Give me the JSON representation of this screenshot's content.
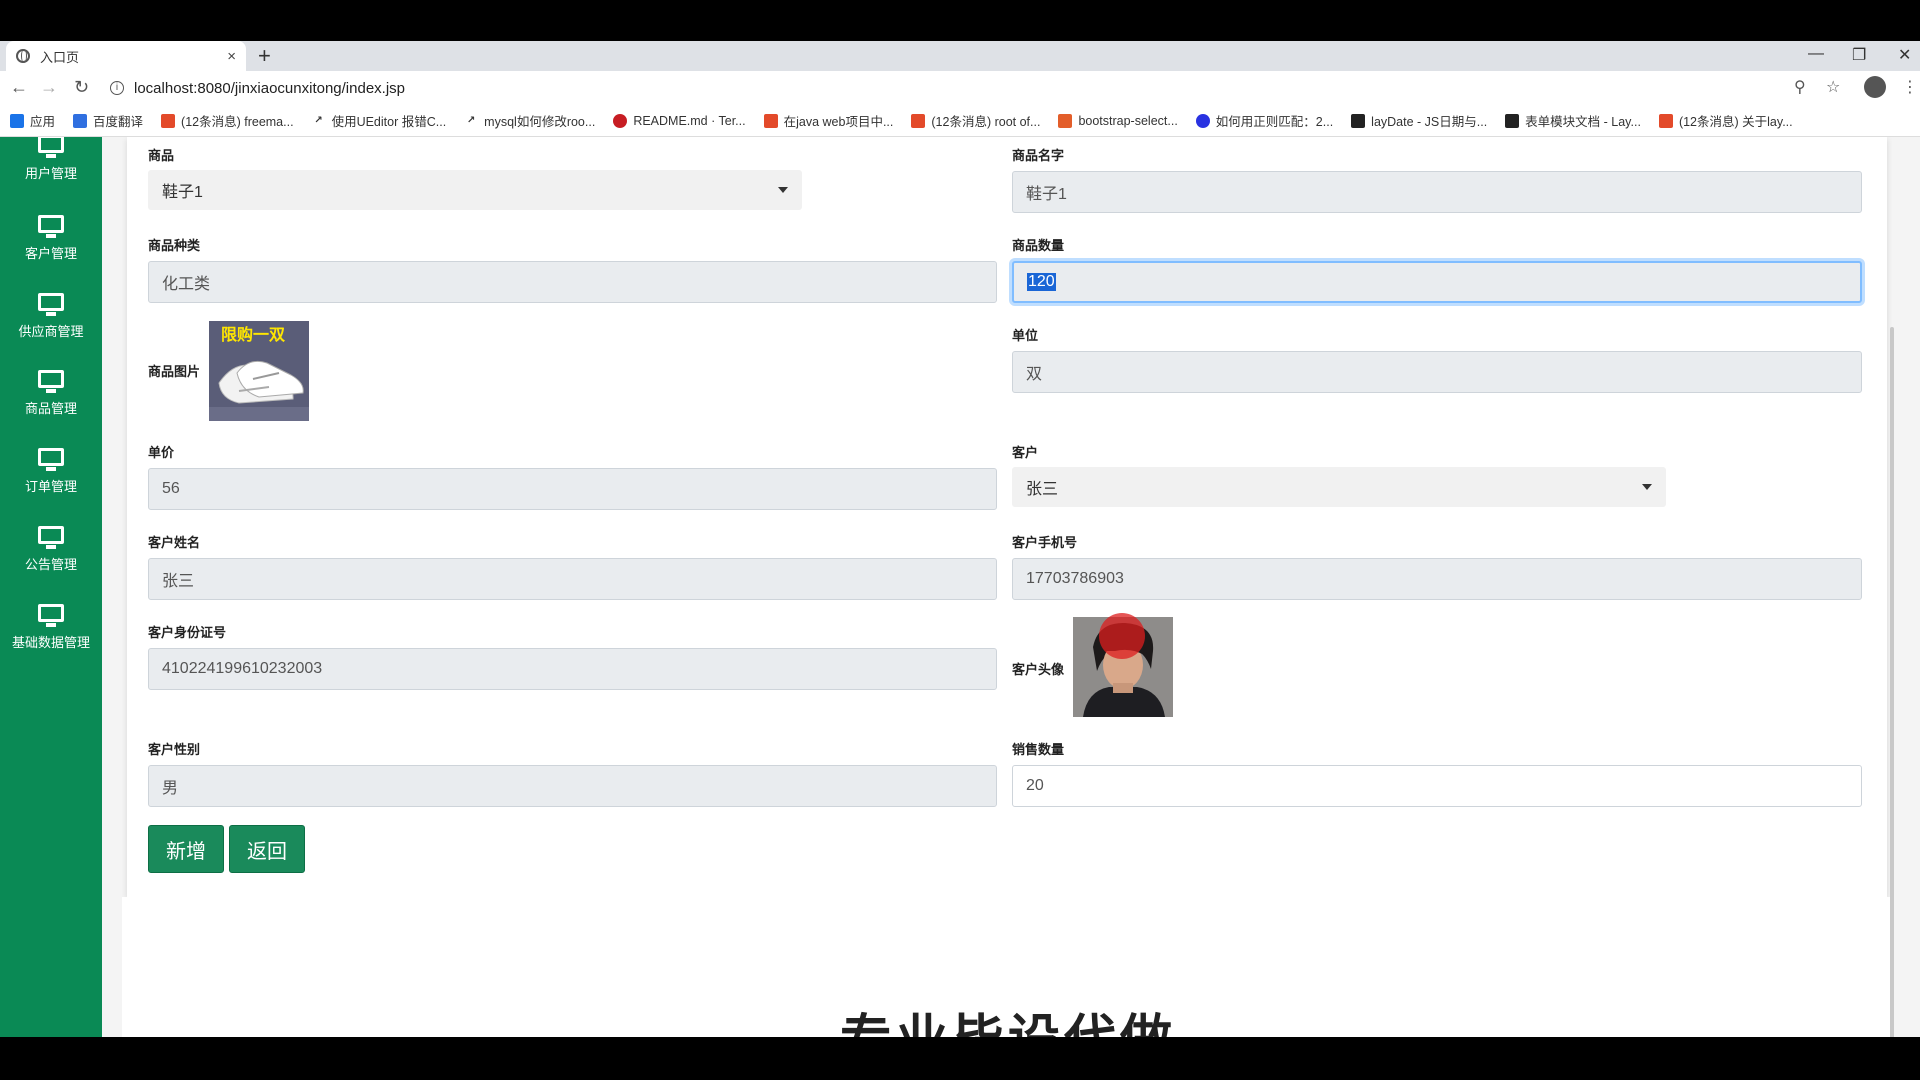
{
  "browser": {
    "tab_title": "入口页",
    "tab_close": "×",
    "new_tab": "+",
    "url": "localhost:8080/jinxiaocunxitong/index.jsp",
    "bookmarks": [
      {
        "label": "应用",
        "icon": "apps-icon",
        "color": "#1a73e8"
      },
      {
        "label": "百度翻译",
        "icon": "baidu-translate-icon",
        "color": "#2f6fe0"
      },
      {
        "label": "(12条消息) freema...",
        "icon": "csdn-icon",
        "color": "#e34a2a"
      },
      {
        "label": "使用UEditor 报错C...",
        "icon": "arrow-icon",
        "color": "#333333"
      },
      {
        "label": "mysql如何修改roo...",
        "icon": "arrow-icon",
        "color": "#333333"
      },
      {
        "label": "README.md · Ter...",
        "icon": "gitee-icon",
        "color": "#c71d23"
      },
      {
        "label": "在java web项目中...",
        "icon": "csdn-icon",
        "color": "#e34a2a"
      },
      {
        "label": "(12条消息) root of...",
        "icon": "csdn-icon",
        "color": "#e34a2a"
      },
      {
        "label": "bootstrap-select...",
        "icon": "bootstrap-icon",
        "color": "#e35e2a"
      },
      {
        "label": "如何用正则匹配：2...",
        "icon": "baidu-icon",
        "color": "#2932e1"
      },
      {
        "label": "layDate - JS日期与...",
        "icon": "layui-icon",
        "color": "#222222"
      },
      {
        "label": "表单模块文档 - Lay...",
        "icon": "layui-icon",
        "color": "#222222"
      },
      {
        "label": "(12条消息) 关于lay...",
        "icon": "csdn-icon",
        "color": "#e34a2a"
      }
    ]
  },
  "sidebar": {
    "items": [
      {
        "label": "用户管理"
      },
      {
        "label": "客户管理"
      },
      {
        "label": "供应商管理"
      },
      {
        "label": "商品管理"
      },
      {
        "label": "订单管理"
      },
      {
        "label": "公告管理"
      },
      {
        "label": "基础数据管理"
      }
    ],
    "color": "#0a8a55"
  },
  "form": {
    "product_label": "商品",
    "product_select": "鞋子1",
    "product_name_label": "商品名字",
    "product_name": "鞋子1",
    "category_label": "商品种类",
    "category": "化工类",
    "quantity_label": "商品数量",
    "quantity": "120",
    "image_label": "商品图片",
    "image_caption": "限购一双",
    "unit_label": "单位",
    "unit": "双",
    "price_label": "单价",
    "price": "56",
    "customer_label": "客户",
    "customer_select": "张三",
    "customer_name_label": "客户姓名",
    "customer_name": "张三",
    "customer_phone_label": "客户手机号",
    "customer_phone": "17703786903",
    "customer_id_label": "客户身份证号",
    "customer_id": "410224199610232003",
    "avatar_label": "客户头像",
    "gender_label": "客户性别",
    "gender": "男",
    "sales_qty_label": "销售数量",
    "sales_qty": "20",
    "add_button": "新增",
    "back_button": "返回"
  },
  "overlay_text": "专业毕设代做",
  "colors": {
    "accent": "#1a8a5b",
    "focus": "#80bdff"
  }
}
